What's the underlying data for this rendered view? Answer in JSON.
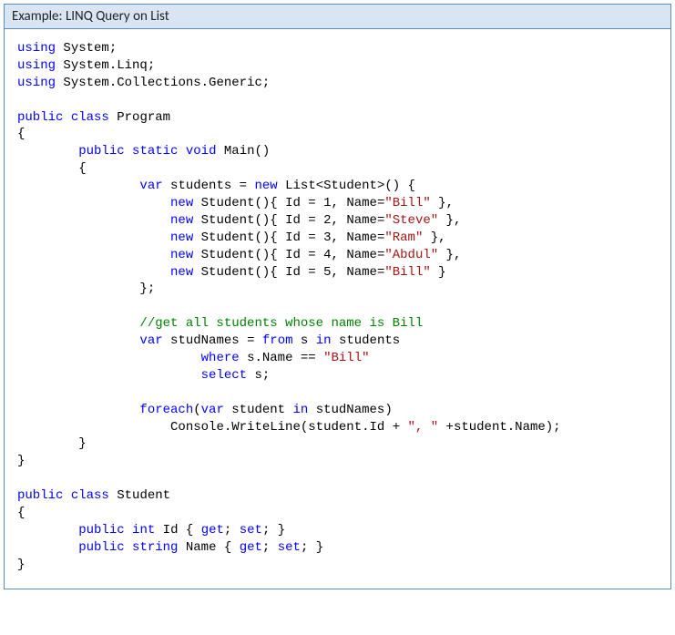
{
  "header": {
    "prefix": "Example:",
    "title": "LINQ Query on List"
  },
  "kw": {
    "using": "using",
    "public": "public",
    "class": "class",
    "static": "static",
    "void": "void",
    "var": "var",
    "new": "new",
    "int": "int",
    "string": "string",
    "get": "get",
    "set": "set",
    "from": "from",
    "in": "in",
    "where": "where",
    "select": "select",
    "foreach": "foreach"
  },
  "ns": {
    "system": "System",
    "linq": "System.Linq",
    "collections": "System.Collections.Generic"
  },
  "cls": {
    "program": "Program",
    "student": "Student",
    "list": "List",
    "console": "Console",
    "writeline": "WriteLine"
  },
  "method": {
    "main": "Main"
  },
  "vars": {
    "students": "students",
    "s": "s",
    "studNames": "studNames",
    "student": "student"
  },
  "fields": {
    "id": "Id",
    "name": "Name"
  },
  "students": {
    "0": {
      "id": "1",
      "name": "\"Bill\""
    },
    "1": {
      "id": "2",
      "name": "\"Steve\""
    },
    "2": {
      "id": "3",
      "name": "\"Ram\""
    },
    "3": {
      "id": "4",
      "name": "\"Abdul\""
    },
    "4": {
      "id": "5",
      "name": "\"Bill\""
    }
  },
  "comment": "//get all students whose name is Bill",
  "strings": {
    "bill": "\"Bill\"",
    "sep": "\", \""
  }
}
